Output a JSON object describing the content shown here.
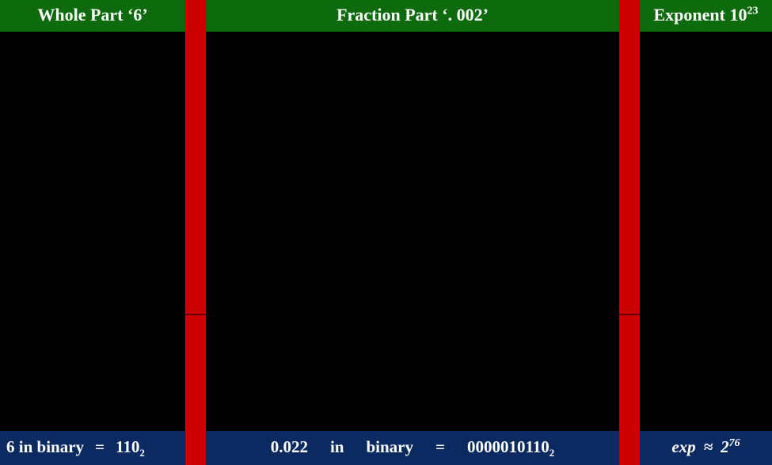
{
  "headers": {
    "whole": "Whole Part ‘",
    "whole_value": "6",
    "whole_suffix": "’",
    "fraction_prefix": "Fraction Part ‘. ",
    "fraction_value": "002",
    "fraction_suffix": "’",
    "exponent_label": "Exponent 10",
    "exponent_power": "23"
  },
  "footers": {
    "whole": {
      "lhs": "6 in binary",
      "eq": "=",
      "rhs": "110",
      "rhs_base": "2"
    },
    "fraction": {
      "lhs_value": "0.022",
      "lhs_in": "in",
      "lhs_word": "binary",
      "eq": "=",
      "rhs": "0000010110",
      "rhs_base": "2"
    },
    "exponent": {
      "lhs": "exp",
      "approx": "≈",
      "base": "2",
      "power": "76"
    }
  }
}
